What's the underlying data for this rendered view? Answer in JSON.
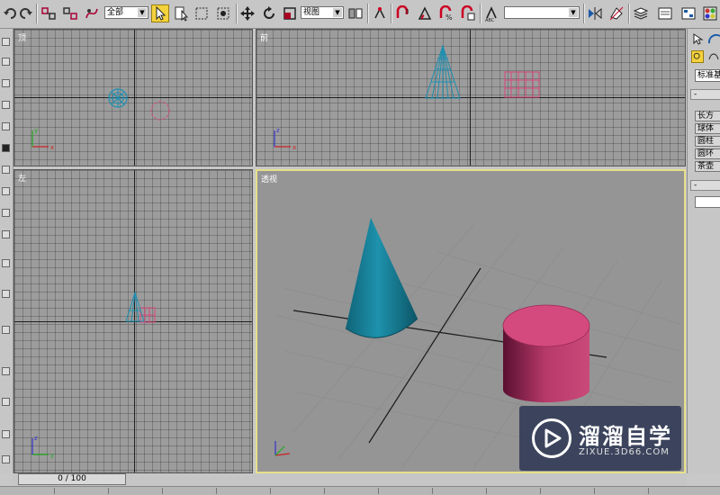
{
  "toolbar": {
    "selection_filter": "全部",
    "ref_coord": "视图",
    "named_selection": ""
  },
  "viewports": {
    "top": {
      "label": "顶"
    },
    "front": {
      "label": "前"
    },
    "left": {
      "label": "左"
    },
    "perspective": {
      "label": "透视"
    }
  },
  "command_panel": {
    "dropdown": "标准基",
    "rollout_minus_1": "-",
    "object_buttons": [
      "长方",
      "球体",
      "圆柱",
      "圆环",
      "茶壶"
    ],
    "rollout_minus_2": "-"
  },
  "timebar": {
    "frame_display": "0 / 100"
  },
  "watermark": {
    "brand": "溜溜自学",
    "url": "ZIXUE.3D66.COM"
  },
  "colors": {
    "viewport_bg": "#9c9c9c",
    "active_border": "#e6e08a",
    "cone": "#1b8ca6",
    "cylinder": "#d8477c"
  }
}
